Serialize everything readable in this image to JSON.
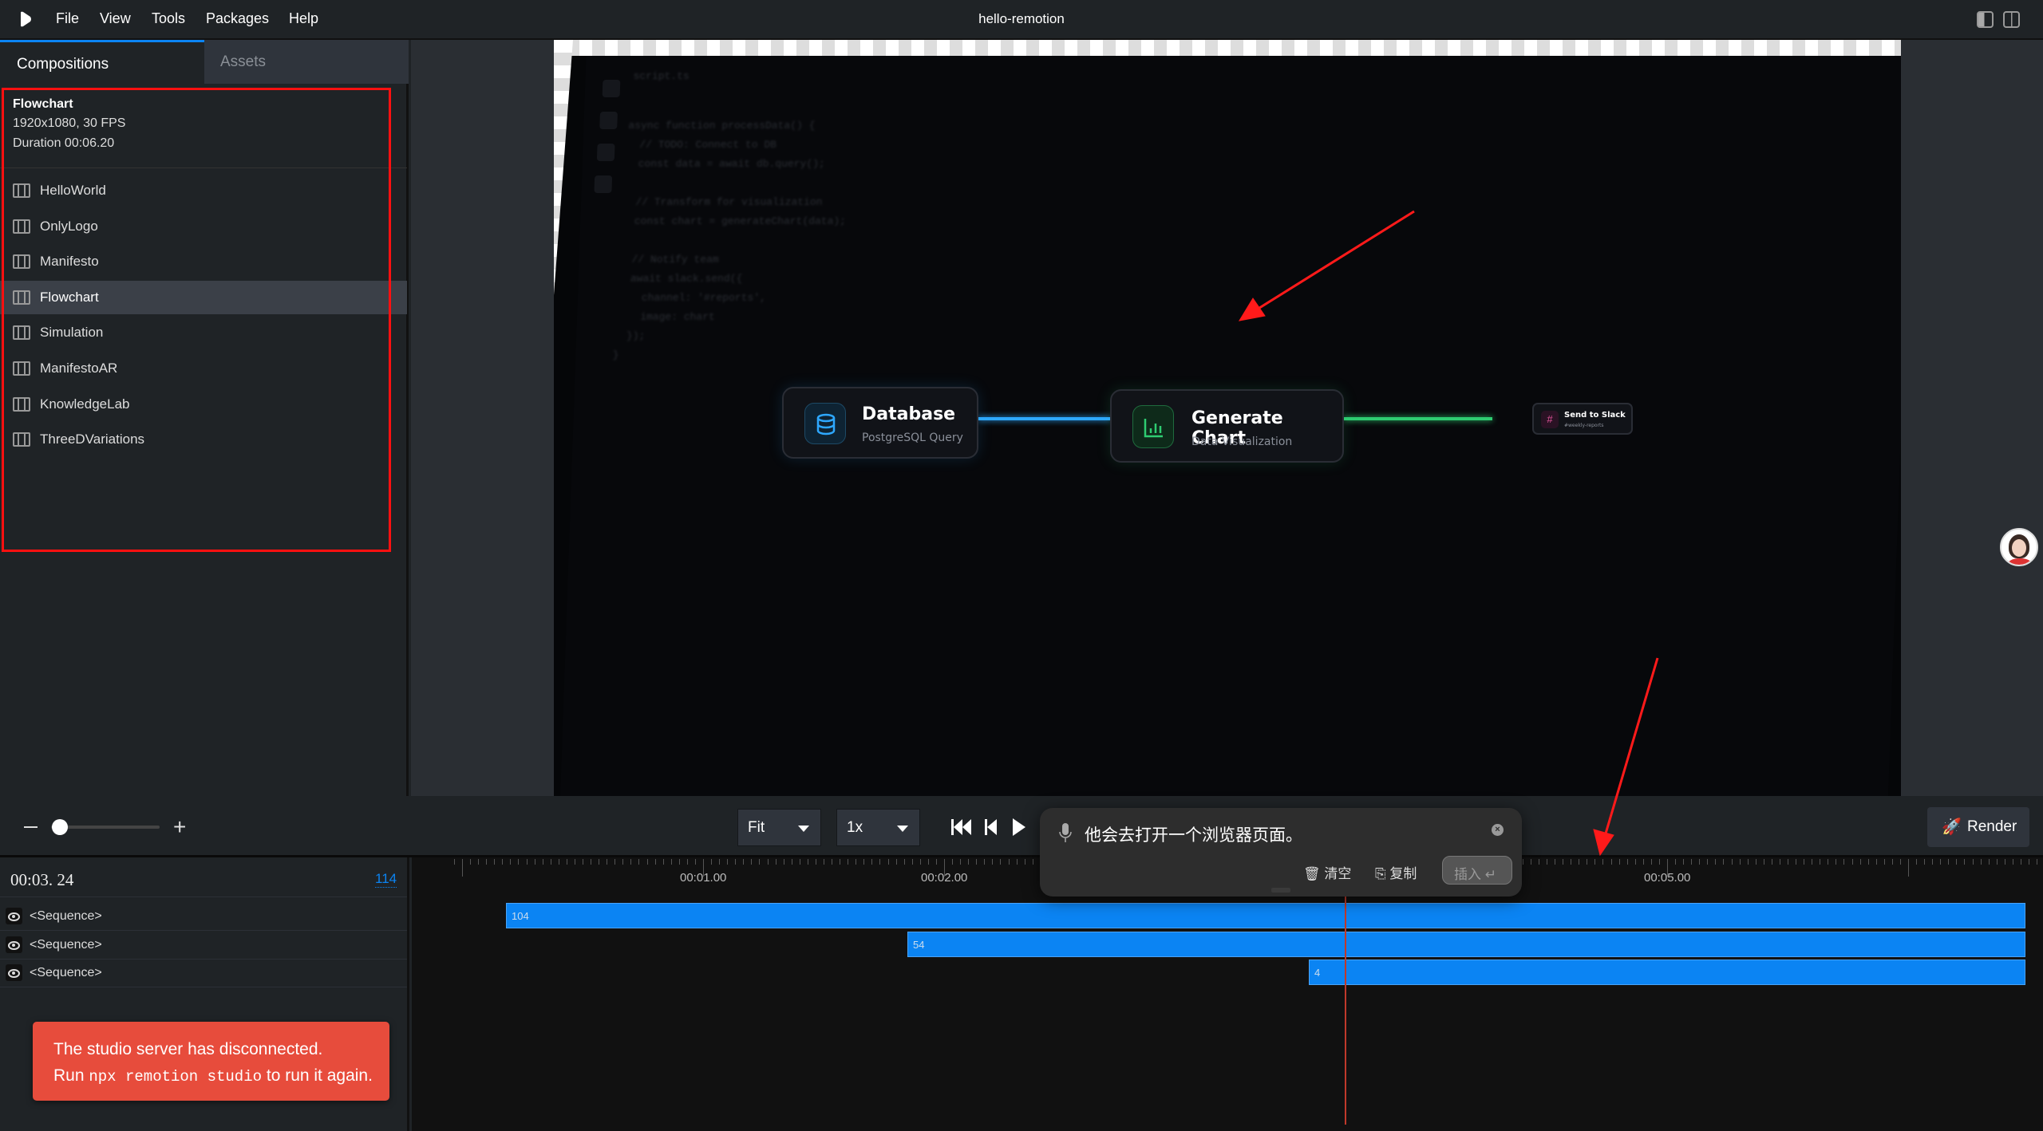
{
  "menubar": {
    "items": [
      "File",
      "View",
      "Tools",
      "Packages",
      "Help"
    ],
    "title": "hello-remotion"
  },
  "sidebar": {
    "tabs": [
      "Compositions",
      "Assets"
    ],
    "selected": {
      "name": "Flowchart",
      "resolution": "1920x1080, 30 FPS",
      "duration": "Duration 00:06.20"
    },
    "items": [
      "HelloWorld",
      "OnlyLogo",
      "Manifesto",
      "Flowchart",
      "Simulation",
      "ManifestoAR",
      "KnowledgeLab",
      "ThreeDVariations"
    ],
    "selected_index": 3
  },
  "preview": {
    "code_tab": "script.ts",
    "code": [
      "async function processData() {",
      "  // TODO: Connect to DB",
      "  const data = await db.query();",
      "",
      "  // Transform for visualization",
      "  const chart = generateChart(data);",
      "",
      "  // Notify team",
      "  await slack.send({",
      "    channel: '#reports',",
      "    image: chart",
      "  });",
      "}"
    ],
    "nodes": [
      {
        "title": "Database",
        "subtitle": "PostgreSQL Query",
        "color": "#2ea8ff",
        "icon": "database-icon"
      },
      {
        "title": "Generate Chart",
        "subtitle": "Data Visualization",
        "color": "#2ecc71",
        "icon": "bar-chart-icon"
      },
      {
        "title": "Send to Slack",
        "subtitle": "#weekly-reports",
        "color": "#e0559a",
        "icon": "hash-icon"
      }
    ]
  },
  "controls": {
    "zoom_select": "Fit",
    "speed_select": "1x",
    "render_label": "Render",
    "zoom_level": 0.1
  },
  "voice_popup": {
    "text": "他会去打开一个浏览器页面。",
    "clear": "清空",
    "copy": "复制",
    "insert": "插入"
  },
  "timeline": {
    "current_time": "00:03. 24",
    "current_frame": "114",
    "ruler_labels": [
      "00:01.00",
      "00:02.00",
      "00:05.00"
    ],
    "tracks": [
      {
        "label": "<Sequence>",
        "duration": "104"
      },
      {
        "label": "<Sequence>",
        "duration": "54"
      },
      {
        "label": "<Sequence>",
        "duration": "4"
      }
    ]
  },
  "toast": {
    "line1": "The studio server has disconnected.",
    "run": "Run",
    "command": "npx remotion studio",
    "rest": "to run it again."
  },
  "colors": {
    "accent": "#0b84f3",
    "error": "#e74c3c",
    "annotation": "#ff1010"
  }
}
